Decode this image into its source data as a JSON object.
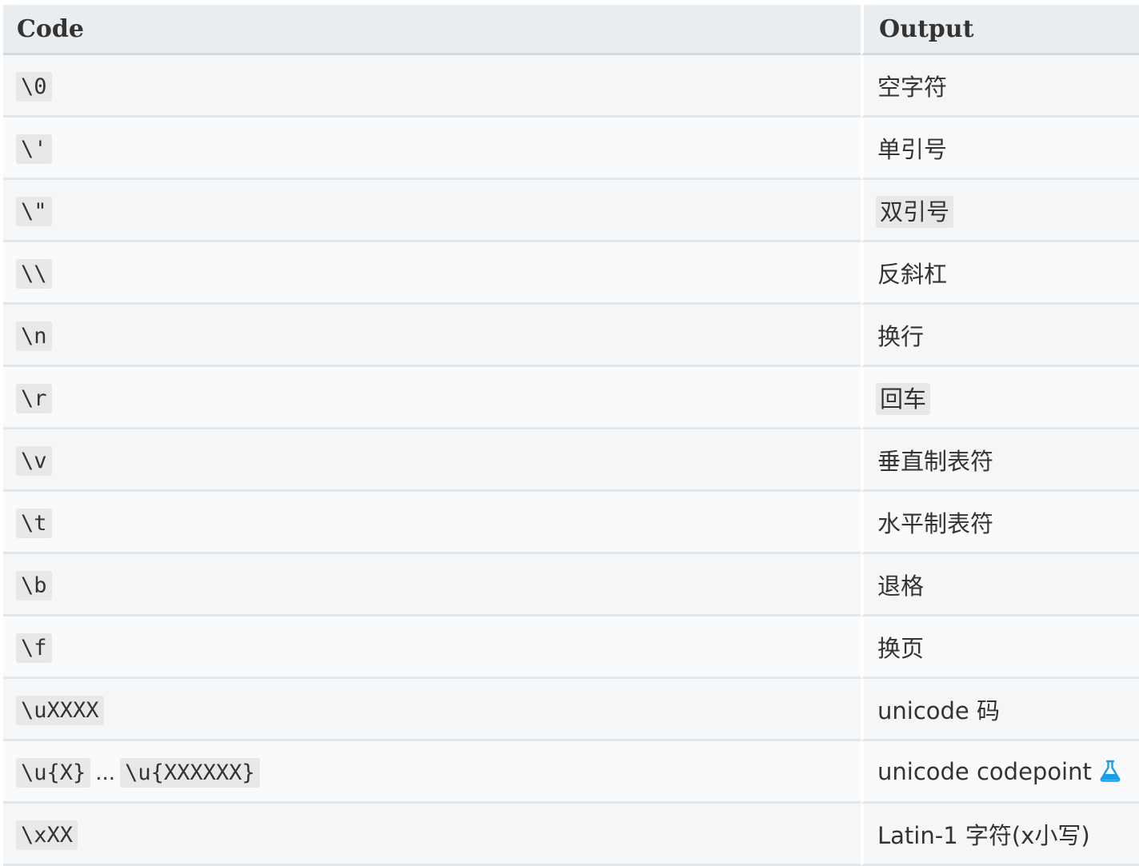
{
  "table": {
    "headers": {
      "code": "Code",
      "output": "Output"
    },
    "rows": [
      {
        "code": "\\0",
        "output": "空字符"
      },
      {
        "code": "\\'",
        "output": "单引号"
      },
      {
        "code": "\\\"",
        "output": "双引号"
      },
      {
        "code": "\\\\",
        "output": "反斜杠"
      },
      {
        "code": "\\n",
        "output": "换行"
      },
      {
        "code": "\\r",
        "output": "回车"
      },
      {
        "code": "\\v",
        "output": "垂直制表符"
      },
      {
        "code": "\\t",
        "output": "水平制表符"
      },
      {
        "code": "\\b",
        "output": "退格"
      },
      {
        "code": "\\f",
        "output": "换页"
      },
      {
        "code": "\\uXXXX",
        "output": "unicode 码"
      },
      {
        "code": "\\u{X}",
        "code_separator": "...",
        "code_end": "\\u{XXXXXX}",
        "output": "unicode codepoint",
        "output_icon": "flask-icon"
      },
      {
        "code": "\\xXX",
        "output": "Latin-1 字符(x小写)"
      }
    ]
  },
  "colors": {
    "header_bg": "#eaedf0",
    "row_bg": "#f5f6f8",
    "row_bg_alt": "#f9fafb",
    "code_bg": "#e7e8ea",
    "icon": "#1b9ee6"
  }
}
